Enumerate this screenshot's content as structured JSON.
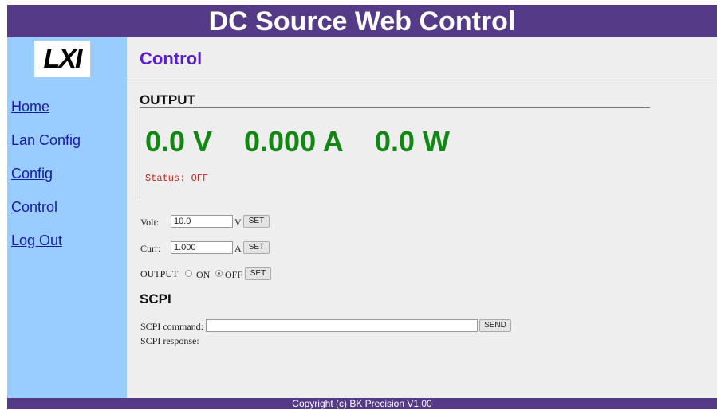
{
  "header": {
    "title": "DC Source Web Control"
  },
  "sidebar": {
    "logo_text": "LXI",
    "items": [
      {
        "label": "Home"
      },
      {
        "label": "Lan Config"
      },
      {
        "label": "Config"
      },
      {
        "label": "Control"
      },
      {
        "label": "Log Out"
      }
    ]
  },
  "main": {
    "page_title": "Control",
    "output": {
      "heading": "OUTPUT",
      "voltage": "0.0 V",
      "current": "0.000 A",
      "power": "0.0 W",
      "status": "Status: OFF",
      "status_color": "#cc2222",
      "reading_color": "#118811"
    },
    "controls": {
      "volt_label": "Volt:",
      "volt_value": "10.0",
      "volt_unit": "V",
      "curr_label": "Curr:",
      "curr_value": "1.000",
      "curr_unit": "A",
      "set_label": "SET",
      "output_label": "OUTPUT",
      "on_label": "ON",
      "off_label": "OFF",
      "output_selected": "OFF"
    },
    "scpi": {
      "heading": "SCPI",
      "command_label": "SCPI command:",
      "command_value": "",
      "send_label": "SEND",
      "response_label": "SCPI response:",
      "response_value": ""
    }
  },
  "footer": {
    "copyright": "Copyright (c) BK Precision V1.00"
  },
  "colors": {
    "header_bg": "#553a87",
    "sidebar_bg": "#99ccff",
    "main_bg": "#eeeeee",
    "title_color": "#5a1fd1"
  }
}
